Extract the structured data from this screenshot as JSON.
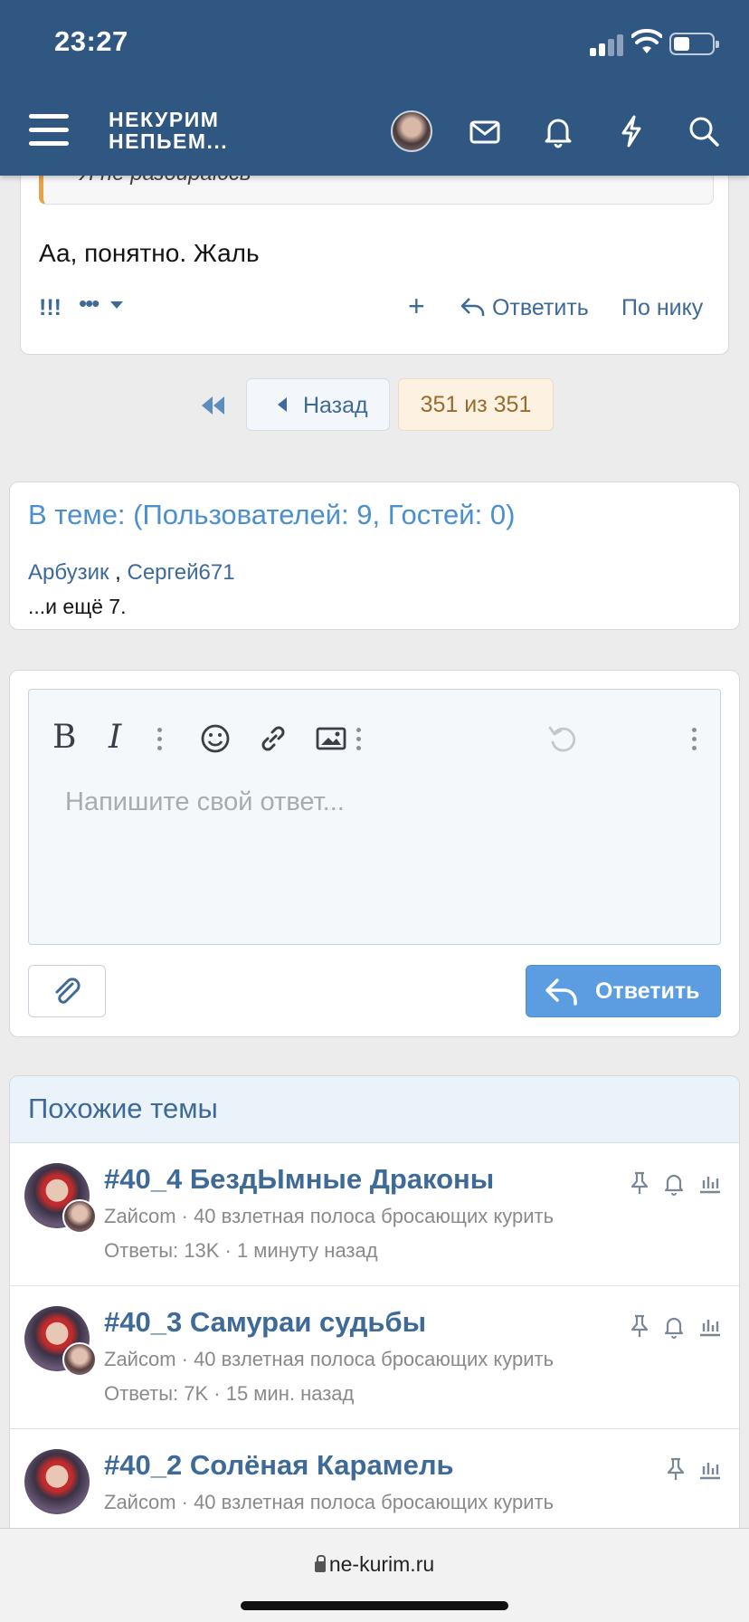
{
  "status_bar": {
    "time": "23:27"
  },
  "header": {
    "logo_line1": "НЕКУРИМ",
    "logo_line2": "НЕПЬЕМ..."
  },
  "post": {
    "quote_text": "Я не разбираюсь",
    "body": "Аа, понятно. Жаль",
    "actions": {
      "react": "!!!",
      "more": "•••",
      "add": "+",
      "reply": "Ответить",
      "by_nick": "По нику"
    }
  },
  "pagination": {
    "back": "Назад",
    "current": "351 из 351"
  },
  "online": {
    "title": "В теме: (Пользователей: 9, Гостей: 0)",
    "users": [
      "Арбузик",
      "Сергей671"
    ],
    "separator": " , ",
    "more": "...и ещё 7."
  },
  "editor": {
    "bold": "B",
    "italic": "I",
    "placeholder": "Напишите свой ответ...",
    "reply_button": "Ответить"
  },
  "similar": {
    "title": "Похожие темы",
    "topics": [
      {
        "title": "#40_4 БездЫмные Драконы",
        "meta": "Zaйcom · 40 взлетная полоса бросающих курить",
        "stats": "Ответы: 13K · 1 минуту назад"
      },
      {
        "title": "#40_3 Самураи судьбы",
        "meta": "Zaйcom · 40 взлетная полоса бросающих курить",
        "stats": "Ответы: 7K · 15 мин. назад"
      },
      {
        "title": "#40_2 Солёная Карамель",
        "meta": "Zaйcom · 40 взлетная полоса бросающих курить",
        "stats": ""
      }
    ]
  },
  "browser": {
    "url": "ne-kurim.ru"
  }
}
